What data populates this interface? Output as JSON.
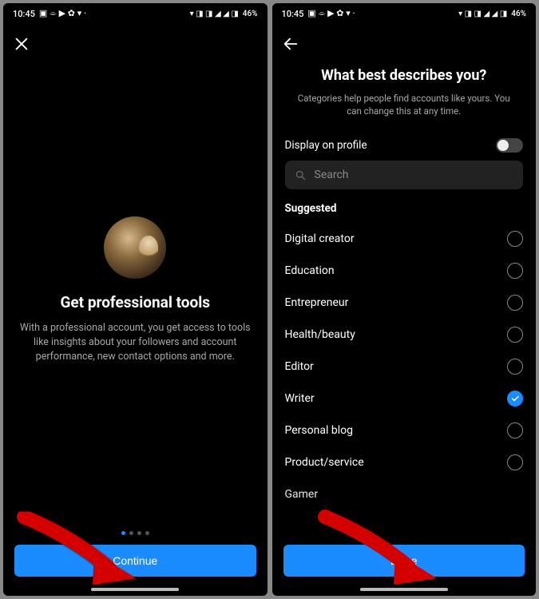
{
  "statusbar": {
    "time": "10:45",
    "battery": "46%"
  },
  "left": {
    "title": "Get professional tools",
    "description": "With a professional account, you get access to tools like insights about your followers and account performance, new contact options and more.",
    "cta": "Continue",
    "pager": {
      "count": 4,
      "active": 0
    }
  },
  "right": {
    "title": "What best describes you?",
    "subtitle": "Categories help people find accounts like yours. You can change this at any time.",
    "display_on_profile_label": "Display on profile",
    "display_on_profile": false,
    "search_placeholder": "Search",
    "section_label": "Suggested",
    "options": [
      {
        "label": "Digital creator",
        "selected": false
      },
      {
        "label": "Education",
        "selected": false
      },
      {
        "label": "Entrepreneur",
        "selected": false
      },
      {
        "label": "Health/beauty",
        "selected": false
      },
      {
        "label": "Editor",
        "selected": false
      },
      {
        "label": "Writer",
        "selected": true
      },
      {
        "label": "Personal blog",
        "selected": false
      },
      {
        "label": "Product/service",
        "selected": false
      }
    ],
    "cutoff_label": "Gamer",
    "cta": "Done"
  }
}
